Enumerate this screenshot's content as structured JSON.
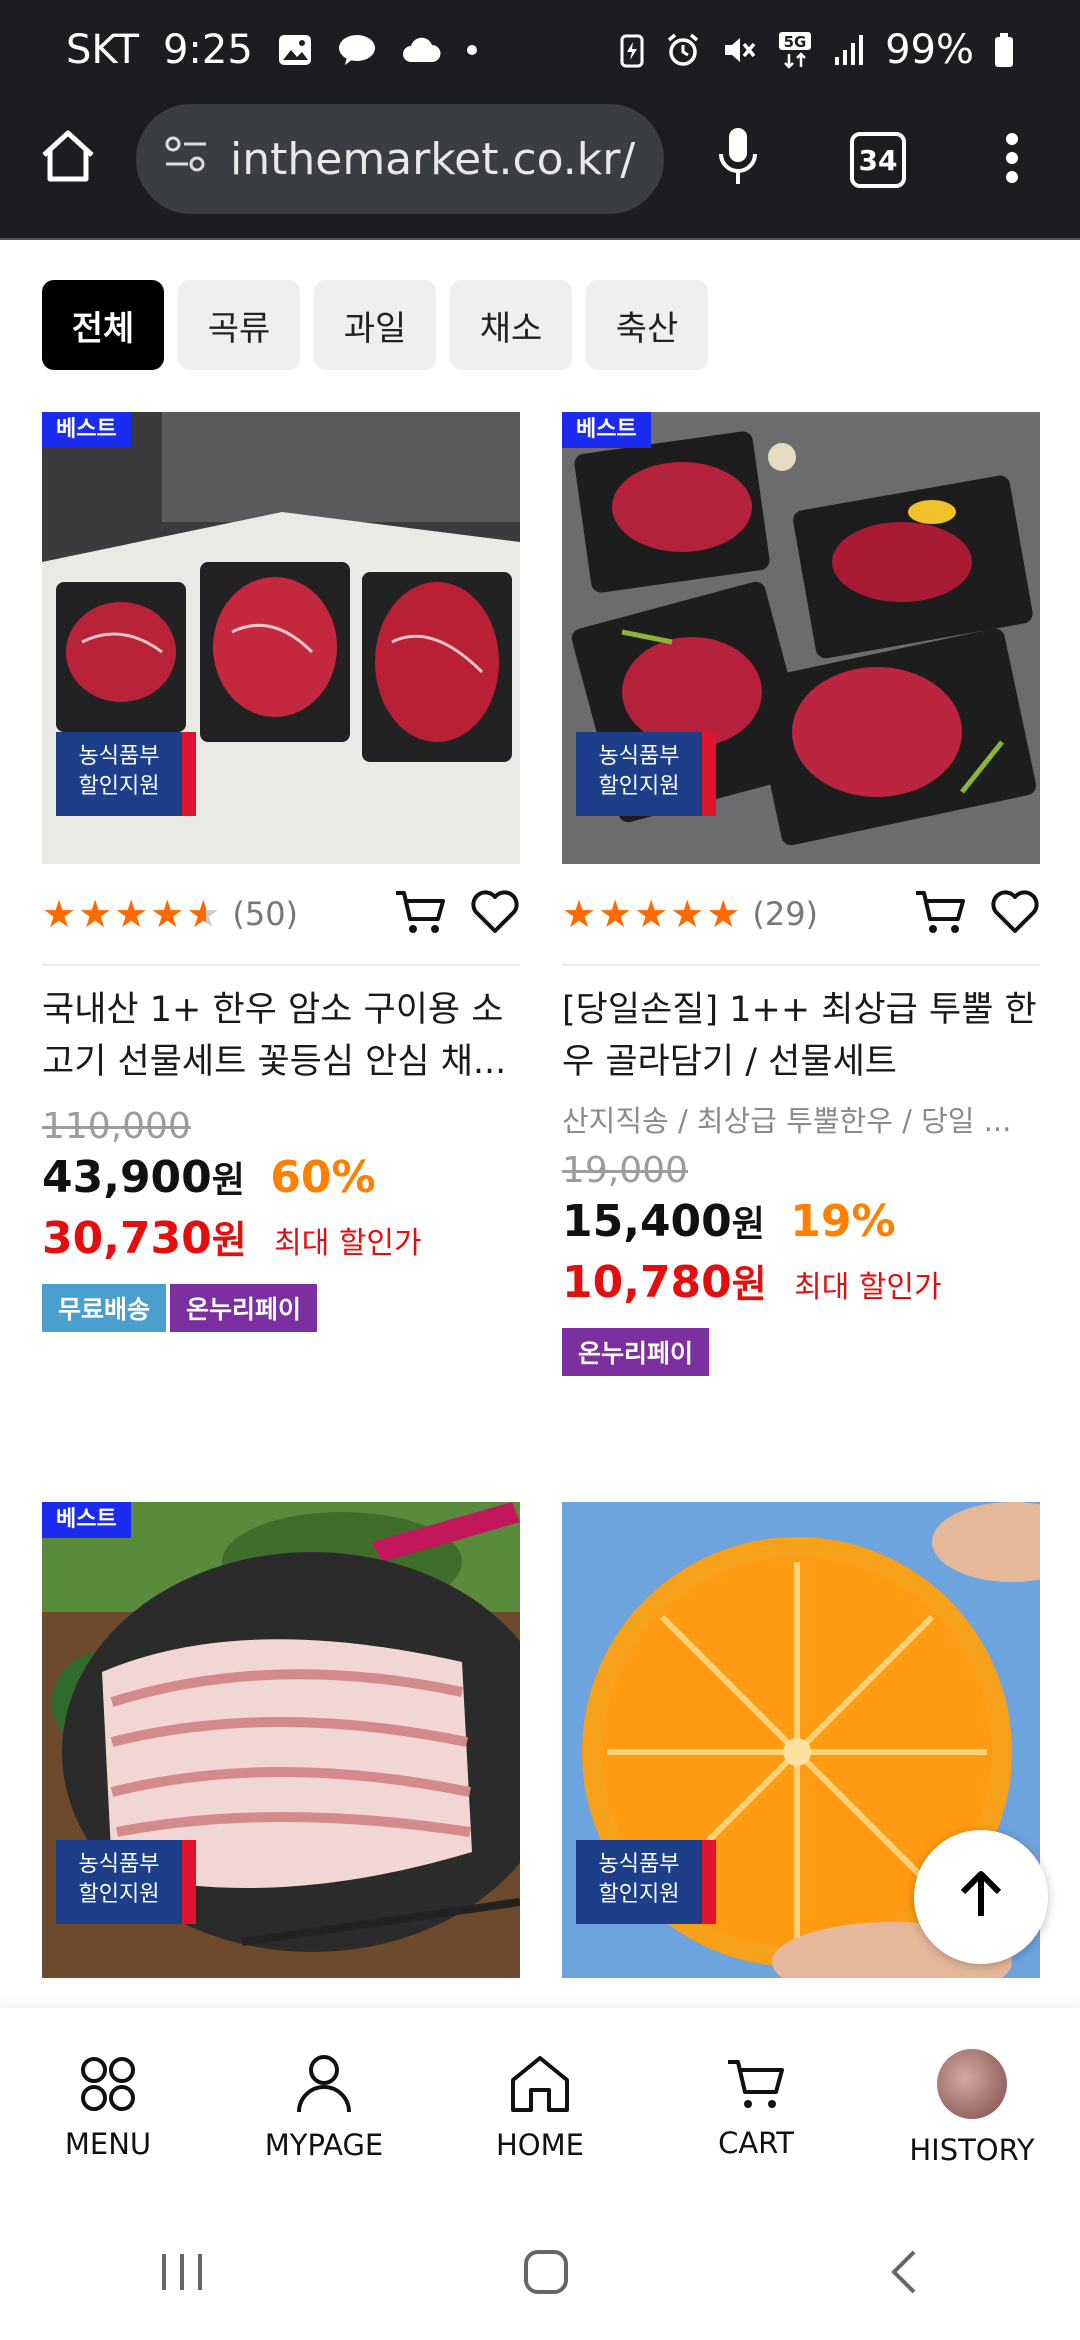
{
  "status_bar": {
    "carrier": "SKT",
    "time": "9:25",
    "battery": "99%",
    "network": "5G"
  },
  "browser": {
    "url": "inthemarket.co.kr/",
    "tab_count": "34"
  },
  "categories": [
    {
      "label": "전체",
      "active": true
    },
    {
      "label": "곡류",
      "active": false
    },
    {
      "label": "과일",
      "active": false
    },
    {
      "label": "채소",
      "active": false
    },
    {
      "label": "축산",
      "active": false
    }
  ],
  "products": [
    {
      "badge": "베스트",
      "support_line1": "농식품부",
      "support_line2": "할인지원",
      "rating_count": "(50)",
      "rating": 4.5,
      "name": "국내산 1+ 한우 암소 구이용 소고기 선물세트 꽃등심 안심 채...",
      "sub": "",
      "original_price": "110,000",
      "price": "43,900",
      "price_unit": "원",
      "discount": "60%",
      "max_price": "30,730",
      "max_unit": "원",
      "max_label": "최대 할인가",
      "tags": [
        "무료배송",
        "온누리페이"
      ]
    },
    {
      "badge": "베스트",
      "support_line1": "농식품부",
      "support_line2": "할인지원",
      "rating_count": "(29)",
      "rating": 5,
      "name": "[당일손질] 1++ 최상급 투뿔 한우 골라담기 / 선물세트",
      "sub": "산지직송 / 최상급 투뿔한우 / 당일 ...",
      "original_price": "19,000",
      "price": "15,400",
      "price_unit": "원",
      "discount": "19%",
      "max_price": "10,780",
      "max_unit": "원",
      "max_label": "최대 할인가",
      "tags": [
        "온누리페이"
      ]
    },
    {
      "badge": "베스트",
      "support_line1": "농식품부",
      "support_line2": "할인지원"
    },
    {
      "badge": "",
      "support_line1": "농식품부",
      "support_line2": "할인지원"
    }
  ],
  "bottom_nav": [
    {
      "label": "MENU",
      "icon": "grid-icon"
    },
    {
      "label": "MYPAGE",
      "icon": "person-icon"
    },
    {
      "label": "HOME",
      "icon": "home-icon"
    },
    {
      "label": "CART",
      "icon": "cart-icon"
    },
    {
      "label": "HISTORY",
      "icon": "history-thumbnail"
    }
  ],
  "colors": {
    "star": "#ff6a00",
    "discount_orange": "#ff7f00",
    "max_red": "#e40e0e",
    "best_badge": "#1b2cf0",
    "free_shipping": "#4b9fcf",
    "onnuri": "#7c2f9f"
  }
}
